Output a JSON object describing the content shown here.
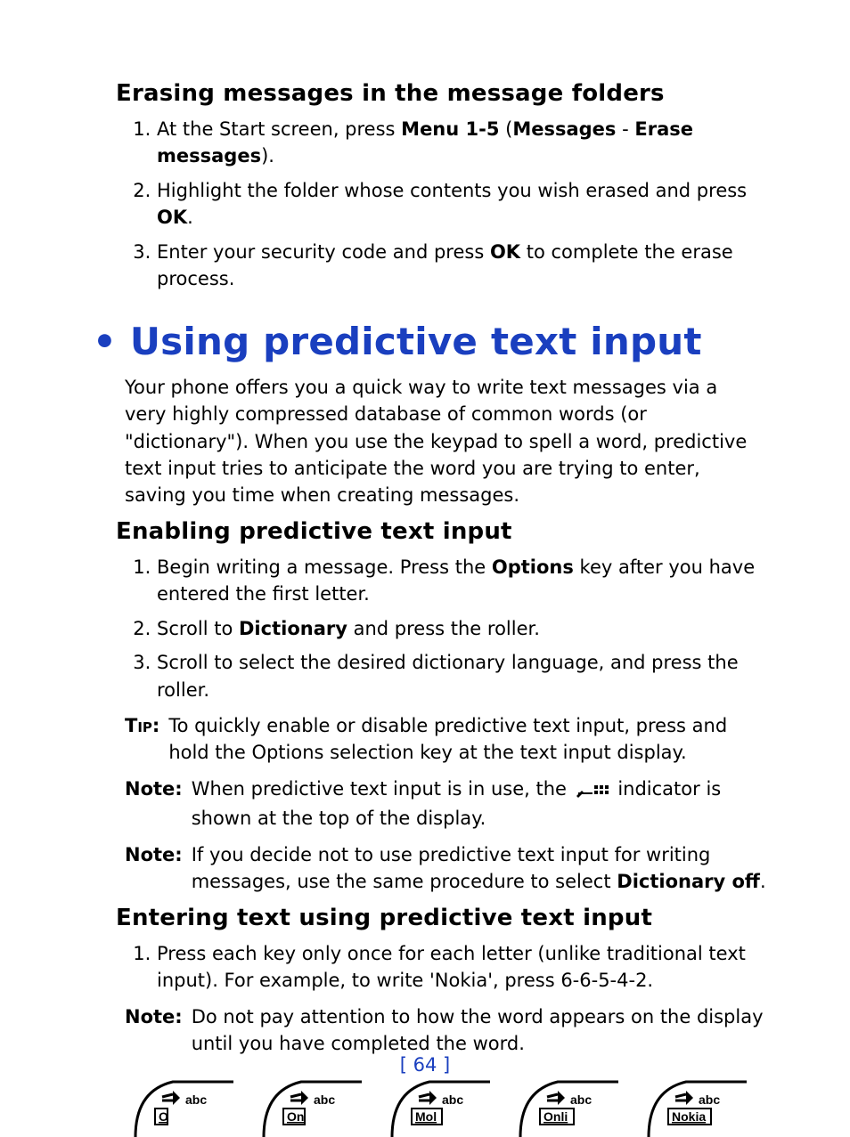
{
  "section1": {
    "heading": "Erasing messages in the message folders",
    "steps": {
      "s1a": "At the Start screen, press ",
      "s1b": "Menu 1-5",
      "s1c": " (",
      "s1d": "Messages",
      "s1e": " - ",
      "s1f": "Erase messages",
      "s1g": ").",
      "s2a": "Highlight the folder whose contents you wish erased and press ",
      "s2b": "OK",
      "s2c": ".",
      "s3a": "Enter your security code and press ",
      "s3b": "OK",
      "s3c": " to complete the erase process."
    }
  },
  "bighead": "Using predictive text input",
  "intro": "Your phone offers you a quick way to write text messages via a very highly compressed database of common words (or \"dictionary\"). When you use the keypad to spell a word, predictive text input tries to anticipate the word you are trying to enter, saving you time when creating messages.",
  "section2": {
    "heading": "Enabling predictive text input",
    "steps": {
      "s1a": "Begin writing a message. Press the ",
      "s1b": "Options",
      "s1c": " key after you have entered the first letter.",
      "s2a": "Scroll to ",
      "s2b": "Dictionary",
      "s2c": " and press the roller.",
      "s3": "Scroll to select the desired dictionary language, and press the roller."
    },
    "tip_label": "Tip:",
    "tip": "To quickly enable or disable predictive text input, press and hold the Options selection key at the text input display.",
    "note1_label": "Note:",
    "note1a": "When predictive text input is in use, the ",
    "note1b": " indicator is shown at the top of the display.",
    "note2_label": "Note:",
    "note2a": "If you decide not to use predictive text input for writing messages, use the same procedure to select ",
    "note2b": "Dictionary off",
    "note2c": "."
  },
  "section3": {
    "heading": "Entering text using predictive text input",
    "steps": {
      "s1": "Press each key only once for each letter (unlike traditional text input). For example, to write 'Nokia', press 6-6-5-4-2."
    },
    "note_label": "Note:",
    "note": "Do not pay attention to how the word appears on the display until you have completed the word."
  },
  "icons": {
    "t9_labels": [
      "O",
      "On",
      "Mol",
      "Onli",
      "Nokia"
    ]
  },
  "pagenum": "[ 64 ]"
}
